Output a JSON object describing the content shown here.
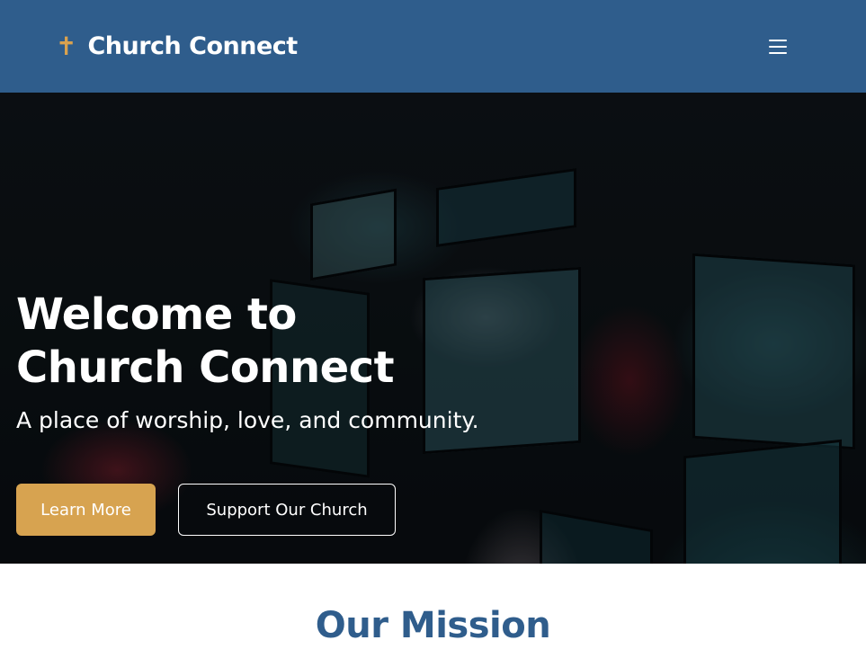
{
  "header": {
    "brand_icon": "cross-icon",
    "brand_name": "Church Connect",
    "menu_icon": "hamburger-menu-icon",
    "background_color": "#2f5d8c",
    "accent_color": "#d9a24f"
  },
  "hero": {
    "title_line1": "Welcome to",
    "title_line2": "Church Connect",
    "subtitle": "A place of worship, love, and community.",
    "primary_button": "Learn More",
    "secondary_button": "Support Our Church",
    "primary_button_color": "#d7a350"
  },
  "mission": {
    "heading": "Our Mission",
    "heading_color": "#2f5d8c"
  }
}
